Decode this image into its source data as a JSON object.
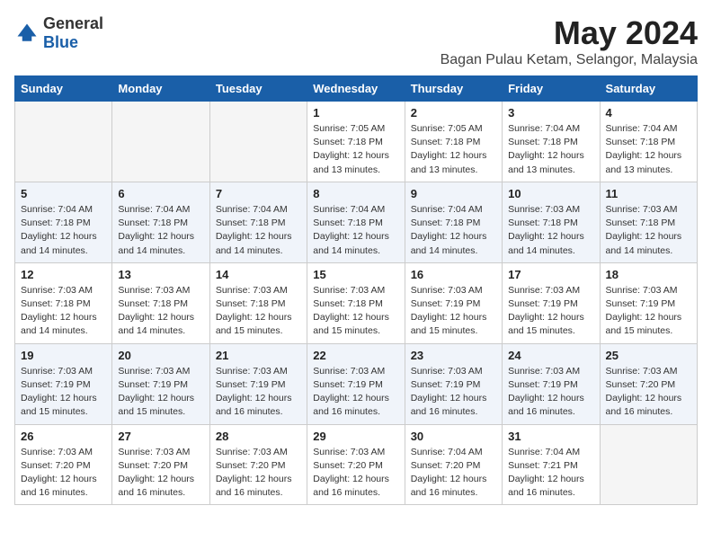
{
  "logo": {
    "general": "General",
    "blue": "Blue"
  },
  "title": "May 2024",
  "subtitle": "Bagan Pulau Ketam, Selangor, Malaysia",
  "weekdays": [
    "Sunday",
    "Monday",
    "Tuesday",
    "Wednesday",
    "Thursday",
    "Friday",
    "Saturday"
  ],
  "weeks": [
    [
      {
        "day": "",
        "info": ""
      },
      {
        "day": "",
        "info": ""
      },
      {
        "day": "",
        "info": ""
      },
      {
        "day": "1",
        "info": "Sunrise: 7:05 AM\nSunset: 7:18 PM\nDaylight: 12 hours\nand 13 minutes."
      },
      {
        "day": "2",
        "info": "Sunrise: 7:05 AM\nSunset: 7:18 PM\nDaylight: 12 hours\nand 13 minutes."
      },
      {
        "day": "3",
        "info": "Sunrise: 7:04 AM\nSunset: 7:18 PM\nDaylight: 12 hours\nand 13 minutes."
      },
      {
        "day": "4",
        "info": "Sunrise: 7:04 AM\nSunset: 7:18 PM\nDaylight: 12 hours\nand 13 minutes."
      }
    ],
    [
      {
        "day": "5",
        "info": "Sunrise: 7:04 AM\nSunset: 7:18 PM\nDaylight: 12 hours\nand 14 minutes."
      },
      {
        "day": "6",
        "info": "Sunrise: 7:04 AM\nSunset: 7:18 PM\nDaylight: 12 hours\nand 14 minutes."
      },
      {
        "day": "7",
        "info": "Sunrise: 7:04 AM\nSunset: 7:18 PM\nDaylight: 12 hours\nand 14 minutes."
      },
      {
        "day": "8",
        "info": "Sunrise: 7:04 AM\nSunset: 7:18 PM\nDaylight: 12 hours\nand 14 minutes."
      },
      {
        "day": "9",
        "info": "Sunrise: 7:04 AM\nSunset: 7:18 PM\nDaylight: 12 hours\nand 14 minutes."
      },
      {
        "day": "10",
        "info": "Sunrise: 7:03 AM\nSunset: 7:18 PM\nDaylight: 12 hours\nand 14 minutes."
      },
      {
        "day": "11",
        "info": "Sunrise: 7:03 AM\nSunset: 7:18 PM\nDaylight: 12 hours\nand 14 minutes."
      }
    ],
    [
      {
        "day": "12",
        "info": "Sunrise: 7:03 AM\nSunset: 7:18 PM\nDaylight: 12 hours\nand 14 minutes."
      },
      {
        "day": "13",
        "info": "Sunrise: 7:03 AM\nSunset: 7:18 PM\nDaylight: 12 hours\nand 14 minutes."
      },
      {
        "day": "14",
        "info": "Sunrise: 7:03 AM\nSunset: 7:18 PM\nDaylight: 12 hours\nand 15 minutes."
      },
      {
        "day": "15",
        "info": "Sunrise: 7:03 AM\nSunset: 7:18 PM\nDaylight: 12 hours\nand 15 minutes."
      },
      {
        "day": "16",
        "info": "Sunrise: 7:03 AM\nSunset: 7:19 PM\nDaylight: 12 hours\nand 15 minutes."
      },
      {
        "day": "17",
        "info": "Sunrise: 7:03 AM\nSunset: 7:19 PM\nDaylight: 12 hours\nand 15 minutes."
      },
      {
        "day": "18",
        "info": "Sunrise: 7:03 AM\nSunset: 7:19 PM\nDaylight: 12 hours\nand 15 minutes."
      }
    ],
    [
      {
        "day": "19",
        "info": "Sunrise: 7:03 AM\nSunset: 7:19 PM\nDaylight: 12 hours\nand 15 minutes."
      },
      {
        "day": "20",
        "info": "Sunrise: 7:03 AM\nSunset: 7:19 PM\nDaylight: 12 hours\nand 15 minutes."
      },
      {
        "day": "21",
        "info": "Sunrise: 7:03 AM\nSunset: 7:19 PM\nDaylight: 12 hours\nand 16 minutes."
      },
      {
        "day": "22",
        "info": "Sunrise: 7:03 AM\nSunset: 7:19 PM\nDaylight: 12 hours\nand 16 minutes."
      },
      {
        "day": "23",
        "info": "Sunrise: 7:03 AM\nSunset: 7:19 PM\nDaylight: 12 hours\nand 16 minutes."
      },
      {
        "day": "24",
        "info": "Sunrise: 7:03 AM\nSunset: 7:19 PM\nDaylight: 12 hours\nand 16 minutes."
      },
      {
        "day": "25",
        "info": "Sunrise: 7:03 AM\nSunset: 7:20 PM\nDaylight: 12 hours\nand 16 minutes."
      }
    ],
    [
      {
        "day": "26",
        "info": "Sunrise: 7:03 AM\nSunset: 7:20 PM\nDaylight: 12 hours\nand 16 minutes."
      },
      {
        "day": "27",
        "info": "Sunrise: 7:03 AM\nSunset: 7:20 PM\nDaylight: 12 hours\nand 16 minutes."
      },
      {
        "day": "28",
        "info": "Sunrise: 7:03 AM\nSunset: 7:20 PM\nDaylight: 12 hours\nand 16 minutes."
      },
      {
        "day": "29",
        "info": "Sunrise: 7:03 AM\nSunset: 7:20 PM\nDaylight: 12 hours\nand 16 minutes."
      },
      {
        "day": "30",
        "info": "Sunrise: 7:04 AM\nSunset: 7:20 PM\nDaylight: 12 hours\nand 16 minutes."
      },
      {
        "day": "31",
        "info": "Sunrise: 7:04 AM\nSunset: 7:21 PM\nDaylight: 12 hours\nand 16 minutes."
      },
      {
        "day": "",
        "info": ""
      }
    ]
  ]
}
